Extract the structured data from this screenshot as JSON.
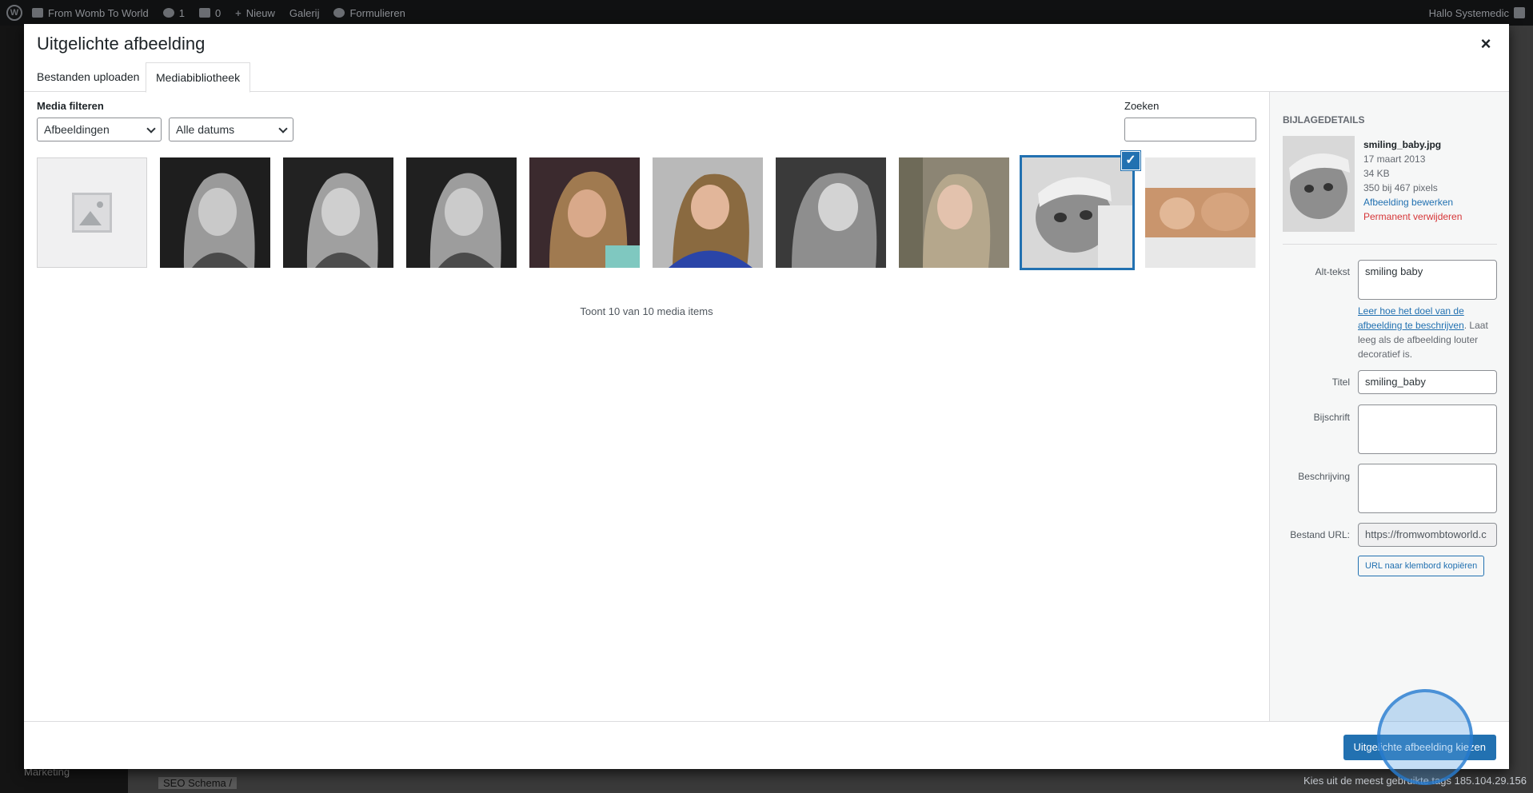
{
  "adminbar": {
    "site_name": "From Womb To World",
    "updates_count": "1",
    "comments_count": "0",
    "new_label": "Nieuw",
    "galerij_label": "Galerij",
    "formulieren_label": "Formulieren",
    "greeting": "Hallo Systemedic"
  },
  "background": {
    "footer_left": "Marketing",
    "footer_seo": "SEO Schema /",
    "footer_right": "Kies uit de meest gebruikte tags 185.104.29.156"
  },
  "modal": {
    "title": "Uitgelichte afbeelding",
    "close_label": "×",
    "tabs": [
      {
        "label": "Bestanden uploaden"
      },
      {
        "label": "Mediabibliotheek"
      }
    ],
    "filters_label": "Media filteren",
    "filter_type": "Afbeeldingen",
    "filter_date": "Alle datums",
    "search_label": "Zoeken",
    "search_value": "",
    "count_text": "Toont 10 van 10 media items",
    "items": [
      {
        "kind": "placeholder"
      },
      {
        "kind": "photo",
        "tone": "bw"
      },
      {
        "kind": "photo",
        "tone": "bw"
      },
      {
        "kind": "photo",
        "tone": "bw"
      },
      {
        "kind": "photo",
        "tone": "color-warm"
      },
      {
        "kind": "photo",
        "tone": "color-blue"
      },
      {
        "kind": "photo",
        "tone": "bw-light"
      },
      {
        "kind": "photo",
        "tone": "color-soft"
      },
      {
        "kind": "photo",
        "tone": "bw-baby",
        "selected": true
      },
      {
        "kind": "photo",
        "tone": "color-baby"
      }
    ],
    "primary_button": "Uitgelichte afbeelding kiezen"
  },
  "details": {
    "heading": "Bijlagedetails",
    "filename": "smiling_baby.jpg",
    "date": "17 maart 2013",
    "size": "34 KB",
    "dimensions": "350 bij 467 pixels",
    "edit_link": "Afbeelding bewerken",
    "delete_link": "Permanent verwijderen",
    "alt_label": "Alt-tekst",
    "alt_value": "smiling baby",
    "help_link": "Leer hoe het doel van de afbeelding te beschrijven",
    "help_rest": ". Laat leeg als de afbeelding louter decoratief is.",
    "title_label": "Titel",
    "title_value": "smiling_baby",
    "caption_label": "Bijschrift",
    "caption_value": "",
    "description_label": "Beschrijving",
    "description_value": "",
    "url_label": "Bestand URL:",
    "url_value": "https://fromwombtoworld.c",
    "copy_button": "URL naar klembord kopiëren"
  },
  "colors": {
    "accent": "#2271b1",
    "danger": "#d63638",
    "adminbar": "#101112"
  }
}
